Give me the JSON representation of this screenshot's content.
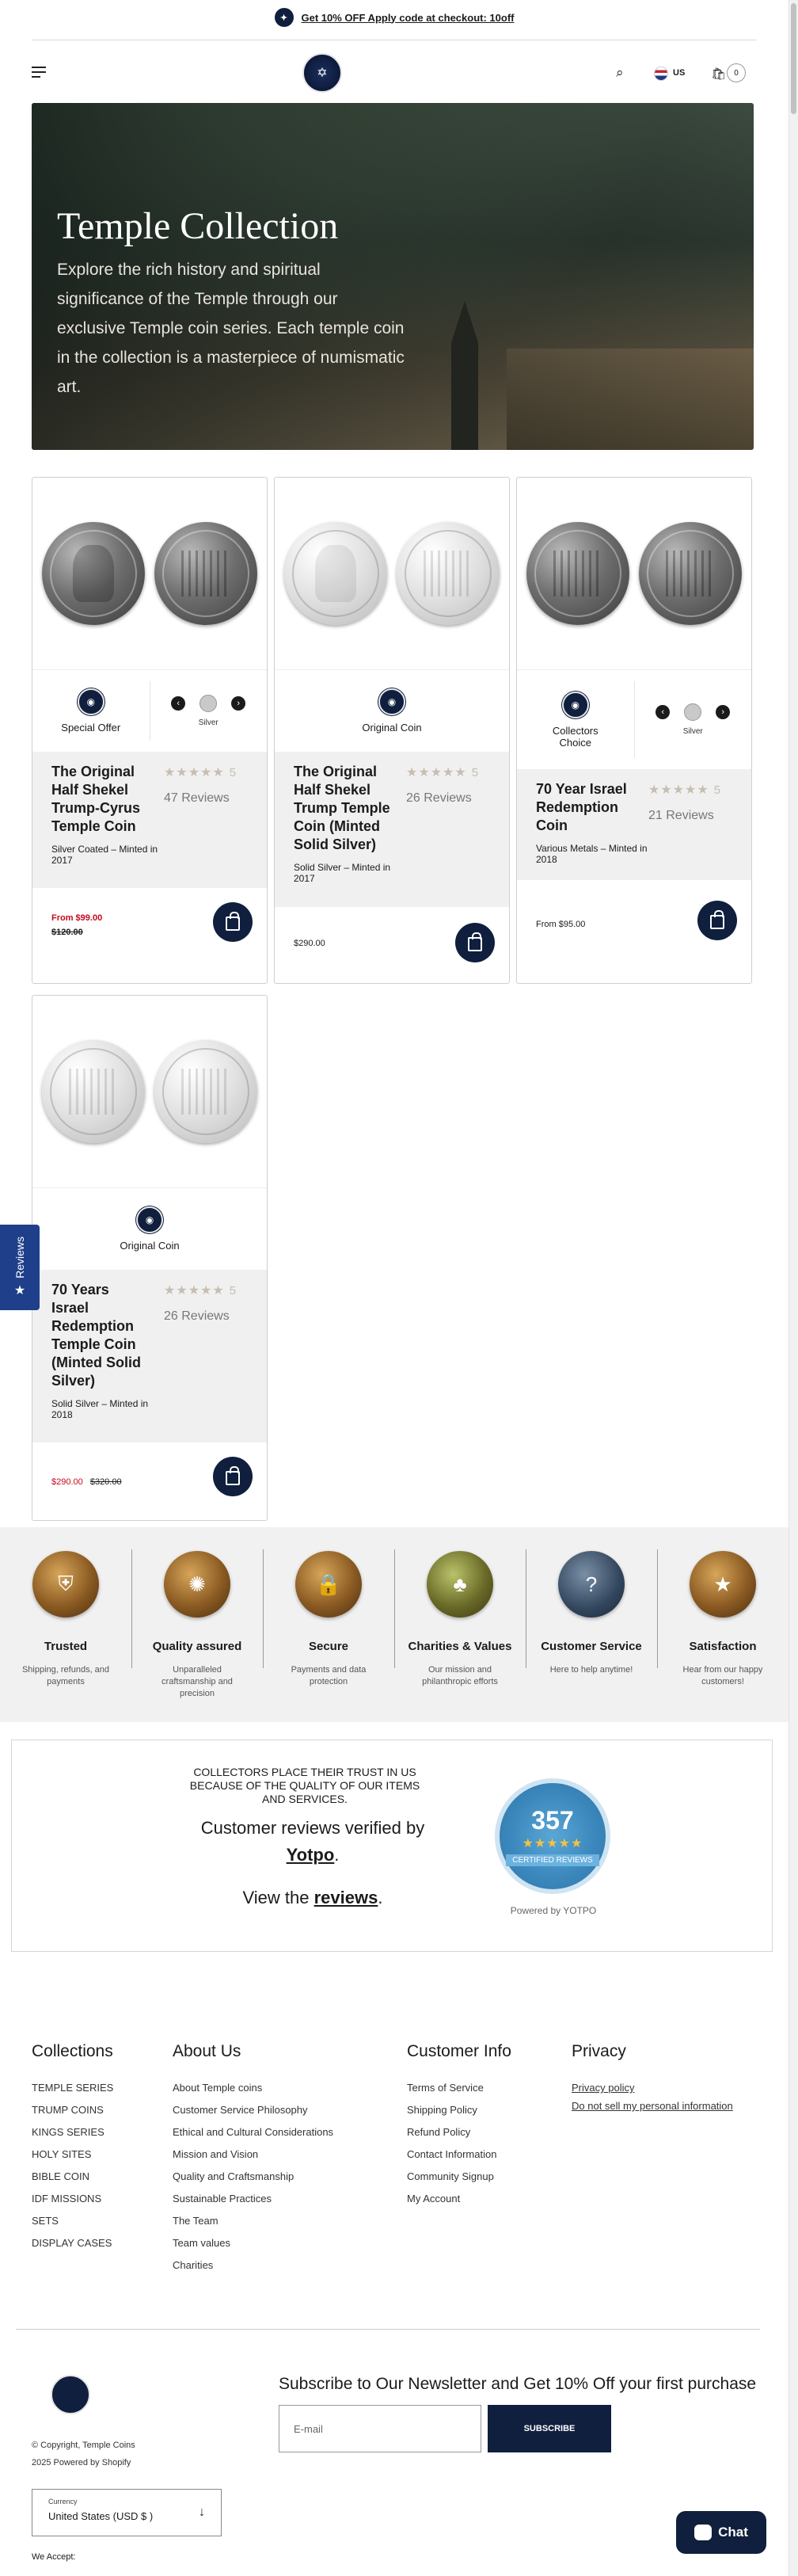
{
  "announcement": {
    "text": "Get 10% OFF Apply code at checkout: 10off",
    "icon": "coin-logo-icon"
  },
  "header": {
    "country": "US",
    "cart_count": "0"
  },
  "hero": {
    "title": "Temple Collection",
    "description": "Explore the rich history and spiritual significance of the Temple through our exclusive Temple coin series. Each temple coin in the collection is a masterpiece of numismatic art."
  },
  "products": [
    {
      "badge": "Special Offer",
      "swatch": "Silver",
      "name": "The Original Half Shekel Trump-Cyrus Temple Coin",
      "rating": "5",
      "reviews": "47 Reviews",
      "meta": "Silver Coated – Minted in 2017",
      "price_prefix": "From $99.00",
      "compare": "$120.00"
    },
    {
      "badge": "Original Coin",
      "name": "The Original Half Shekel Trump Temple Coin (Minted Solid Silver)",
      "rating": "5",
      "reviews": "26 Reviews",
      "meta": "Solid Silver – Minted in 2017",
      "price": "$290.00"
    },
    {
      "badge": "Collectors Choice",
      "swatch": "Silver",
      "name": "70 Year Israel Redemption Coin",
      "rating": "5",
      "reviews": "21 Reviews",
      "meta": "Various Metals – Minted in 2018",
      "price": "From $95.00"
    },
    {
      "badge": "Original Coin",
      "name": "70 Years Israel Redemption Temple Coin (Minted Solid Silver)",
      "rating": "5",
      "reviews": "26 Reviews",
      "meta": "Solid Silver – Minted in 2018",
      "price_sale": "$290.00",
      "compare": "$320.00"
    }
  ],
  "reviews_tab": {
    "label": "Reviews"
  },
  "features": [
    {
      "title": "Trusted",
      "desc": "Shipping, refunds, and payments"
    },
    {
      "title": "Quality assured",
      "desc": "Unparalleled craftsmanship and precision"
    },
    {
      "title": "Secure",
      "desc": "Payments and data protection"
    },
    {
      "title": "Charities & Values",
      "desc": "Our mission and philanthropic efforts"
    },
    {
      "title": "Customer Service",
      "desc": "Here to help anytime!"
    },
    {
      "title": "Satisfaction",
      "desc": "Hear from our happy customers!"
    }
  ],
  "yotpo": {
    "trust": "Collectors place their trust in us because of the quality of our items and services.",
    "verified_pre": "Customer reviews verified by",
    "verified_brand": "Yotpo",
    "view_pre": "View the",
    "view_link": "reviews",
    "count": "357",
    "certified": "CERTIFIED REVIEWS",
    "powered": "Powered by YOTPO"
  },
  "footer": {
    "collections": {
      "title": "Collections",
      "links": [
        "TEMPLE SERIES",
        "TRUMP COINS",
        "KINGS SERIES",
        "HOLY SITES",
        "BIBLE COIN",
        "IDF MISSIONS",
        "SETS",
        "DISPLAY CASES"
      ]
    },
    "about": {
      "title": "About Us",
      "links": [
        "About Temple coins",
        "Customer Service Philosophy",
        "Ethical and Cultural Considerations",
        "Mission and Vision",
        "Quality and Craftsmanship",
        "Sustainable Practices",
        "The Team",
        "Team values",
        "Charities"
      ]
    },
    "info": {
      "title": "Customer Info",
      "links": [
        "Terms of Service",
        "Shipping Policy",
        "Refund Policy",
        "Contact Information",
        "Community Signup",
        "My Account"
      ]
    },
    "privacy": {
      "title": "Privacy",
      "links": [
        "Privacy policy",
        "Do not sell my personal information"
      ]
    },
    "copyright": "© Copyright, Temple Coins",
    "powered": "2025 Powered by Shopify",
    "currency_label": "Currency",
    "currency_value": "United States (USD $ )",
    "we_accept": "We Accept:",
    "newsletter": "Subscribe to Our Newsletter and Get 10% Off your first purchase",
    "email_placeholder": "E-mail",
    "subscribe": "SUBSCRIBE"
  },
  "chat": {
    "label": "Chat"
  }
}
